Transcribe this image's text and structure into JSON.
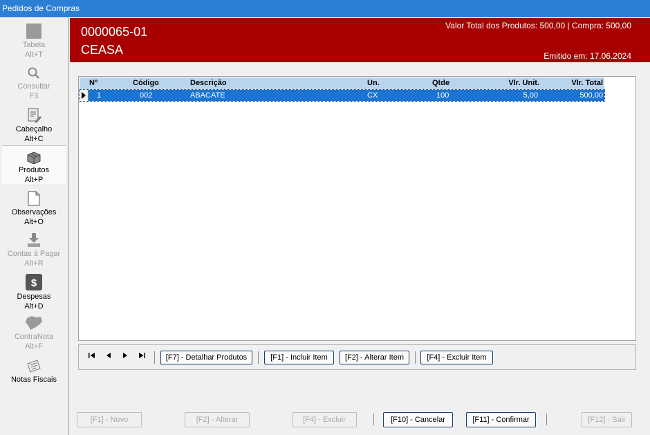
{
  "window": {
    "title": "Pedidos de Compras"
  },
  "sidebar": {
    "items": [
      {
        "label": "Tabela",
        "shortcut": "Alt+T"
      },
      {
        "label": "Consultar",
        "shortcut": "F3"
      },
      {
        "label": "Cabeçalho",
        "shortcut": "Alt+C"
      },
      {
        "label": "Produtos",
        "shortcut": "Alt+P"
      },
      {
        "label": "Observações",
        "shortcut": "Alt+O"
      },
      {
        "label": "Contas à Pagar",
        "shortcut": "Alt+R"
      },
      {
        "label": "Despesas",
        "shortcut": "Alt+D"
      },
      {
        "label": "ContraNota",
        "shortcut": "Alt+F"
      },
      {
        "label": "Notas Fiscais",
        "shortcut": ""
      }
    ]
  },
  "header": {
    "order_number": "0000065-01",
    "supplier": "CEASA",
    "totals": "Valor Total dos Produtos: 500,00 | Compra: 500,00",
    "issued": "Emitido em: 17.06.2024",
    "color": "#a80000"
  },
  "grid": {
    "columns": [
      "Nº",
      "Código",
      "Descrição",
      "Un.",
      "Qtde",
      "Vlr. Unit.",
      "Vlr. Total"
    ],
    "rows": [
      {
        "n": "1",
        "codigo": "002",
        "descricao": "ABACATE",
        "un": "CX",
        "qtde": "100",
        "vlr_unit": "5,00",
        "vlr_total": "500,00"
      }
    ],
    "selected_color": "#1a74d1"
  },
  "nav": {
    "first": "⏮",
    "prev": "◀",
    "next": "▶",
    "last": "⏭",
    "detalhar": "[F7] - Detalhar Produtos",
    "incluir": "[F1] - Incluir Item",
    "alterar": "[F2] - Alterar Item",
    "excluir": "[F4] - Excluir  Item"
  },
  "footer": {
    "novo": "[F1] - Novo",
    "alterar": "[F2] - Alterar",
    "excluir": "[F4] - Excluir",
    "cancelar": "[F10] - Cancelar",
    "confirmar": "[F11] - Confirmar",
    "sair": "[F12] - Sair"
  }
}
